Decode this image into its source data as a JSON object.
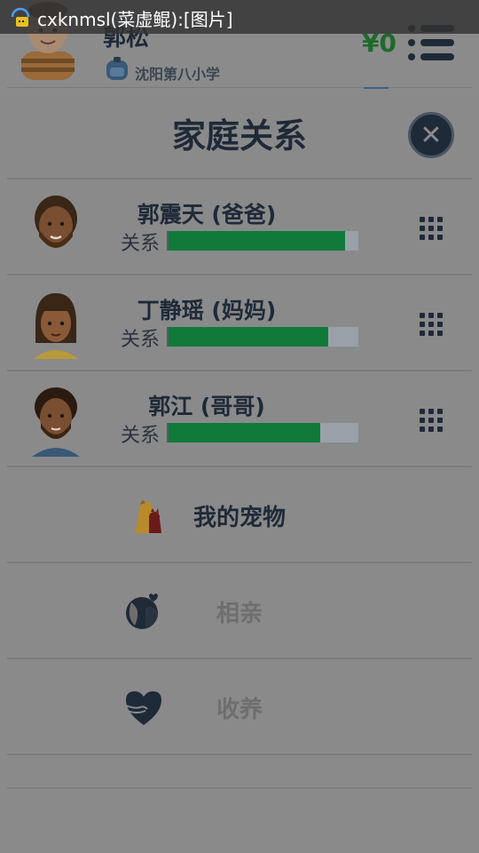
{
  "notification": {
    "text": "cxknmsl(菜虚鲲):[图片]"
  },
  "background_header": {
    "user_name": "郭松",
    "school": "沈阳第八小学",
    "money": "¥0"
  },
  "dialog": {
    "title": "家庭关系",
    "relation_label": "关系",
    "members": [
      {
        "name": "郭震天 (爸爸)",
        "relation_level": 0.93
      },
      {
        "name": "丁静瑶 (妈妈)",
        "relation_level": 0.84
      },
      {
        "name": "郭江 (哥哥)",
        "relation_level": 0.8
      }
    ],
    "actions": [
      {
        "label": "我的宠物",
        "icon": "pet-dog-icon",
        "enabled": true
      },
      {
        "label": "相亲",
        "icon": "couple-icon",
        "enabled": false
      },
      {
        "label": "收养",
        "icon": "heart-hands-icon",
        "enabled": false
      }
    ]
  },
  "colors": {
    "primary_dark": "#1f2a38",
    "relation_bar": "#0f7a3a",
    "money_green": "#1e6a2a",
    "dim_overlay": "#8a8a8a"
  }
}
